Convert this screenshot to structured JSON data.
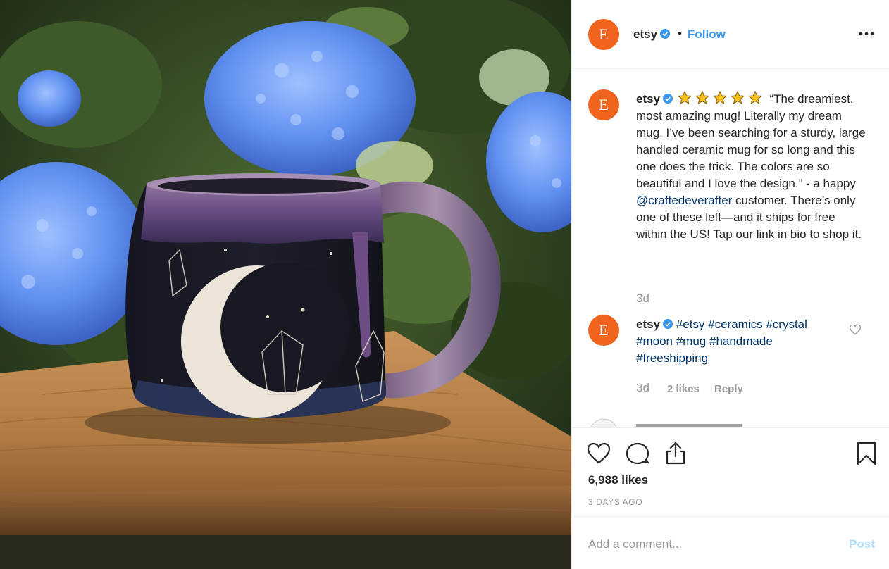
{
  "colors": {
    "accent": "#3897f0",
    "brand_avatar": "#f1641e",
    "hashtag": "#003569",
    "muted": "#999999"
  },
  "photo": {
    "icon": "mug-photo"
  },
  "header": {
    "avatar_letter": "E",
    "username": "etsy",
    "separator": "•",
    "follow_label": "Follow",
    "more_icon": "more-horizontal-icon"
  },
  "caption": {
    "avatar_letter": "E",
    "username": "etsy",
    "stars": "★★★★★",
    "text_part1": " “The dreamiest, most amazing mug! Literally my dream mug. I’ve been searching for a sturdy, large handled ceramic mug for so long and this one does the trick. The colors are so beautiful and I love the design.” - a happy ",
    "mention": "@craftedeverafter",
    "text_part2": " customer. There’s only one of these left—and it ships for free within the US! Tap our link in bio to shop it.",
    "time": "3d"
  },
  "comment": {
    "avatar_letter": "E",
    "username": "etsy",
    "tags": [
      "#etsy",
      "#ceramics",
      "#crystal",
      "#moon",
      "#mug",
      "#handmade",
      "#freeshipping"
    ],
    "time": "3d",
    "likes": "2 likes",
    "reply": "Reply"
  },
  "actions": {
    "like_icon": "heart-icon",
    "comment_icon": "comment-icon",
    "share_icon": "share-icon",
    "save_icon": "bookmark-icon",
    "likes_count": "6,988 likes",
    "date": "3 DAYS AGO"
  },
  "add_comment": {
    "placeholder": "Add a comment...",
    "post_label": "Post"
  }
}
